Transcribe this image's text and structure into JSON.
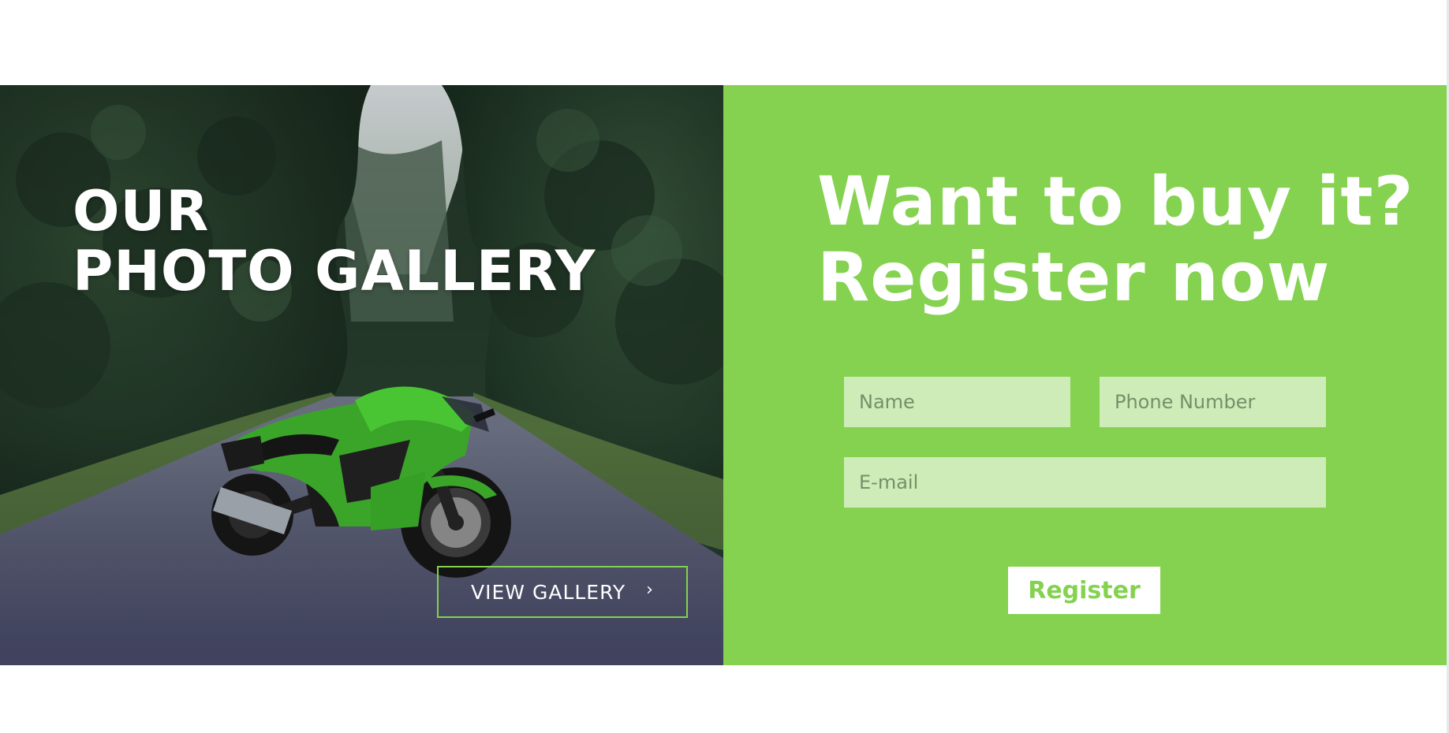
{
  "gallery": {
    "title_line1": "OUR",
    "title_line2": "PHOTO GALLERY",
    "button_label": "VIEW GALLERY",
    "button_icon": "chevron-right-icon",
    "accent_color": "#83d14f"
  },
  "register": {
    "heading_line1": "Want to buy it?",
    "heading_line2": "Register now",
    "name_placeholder": "Name",
    "phone_placeholder": "Phone Number",
    "email_placeholder": "E-mail",
    "button_label": "Register",
    "background_color": "#84d24f",
    "field_color": "#cdecb8"
  }
}
